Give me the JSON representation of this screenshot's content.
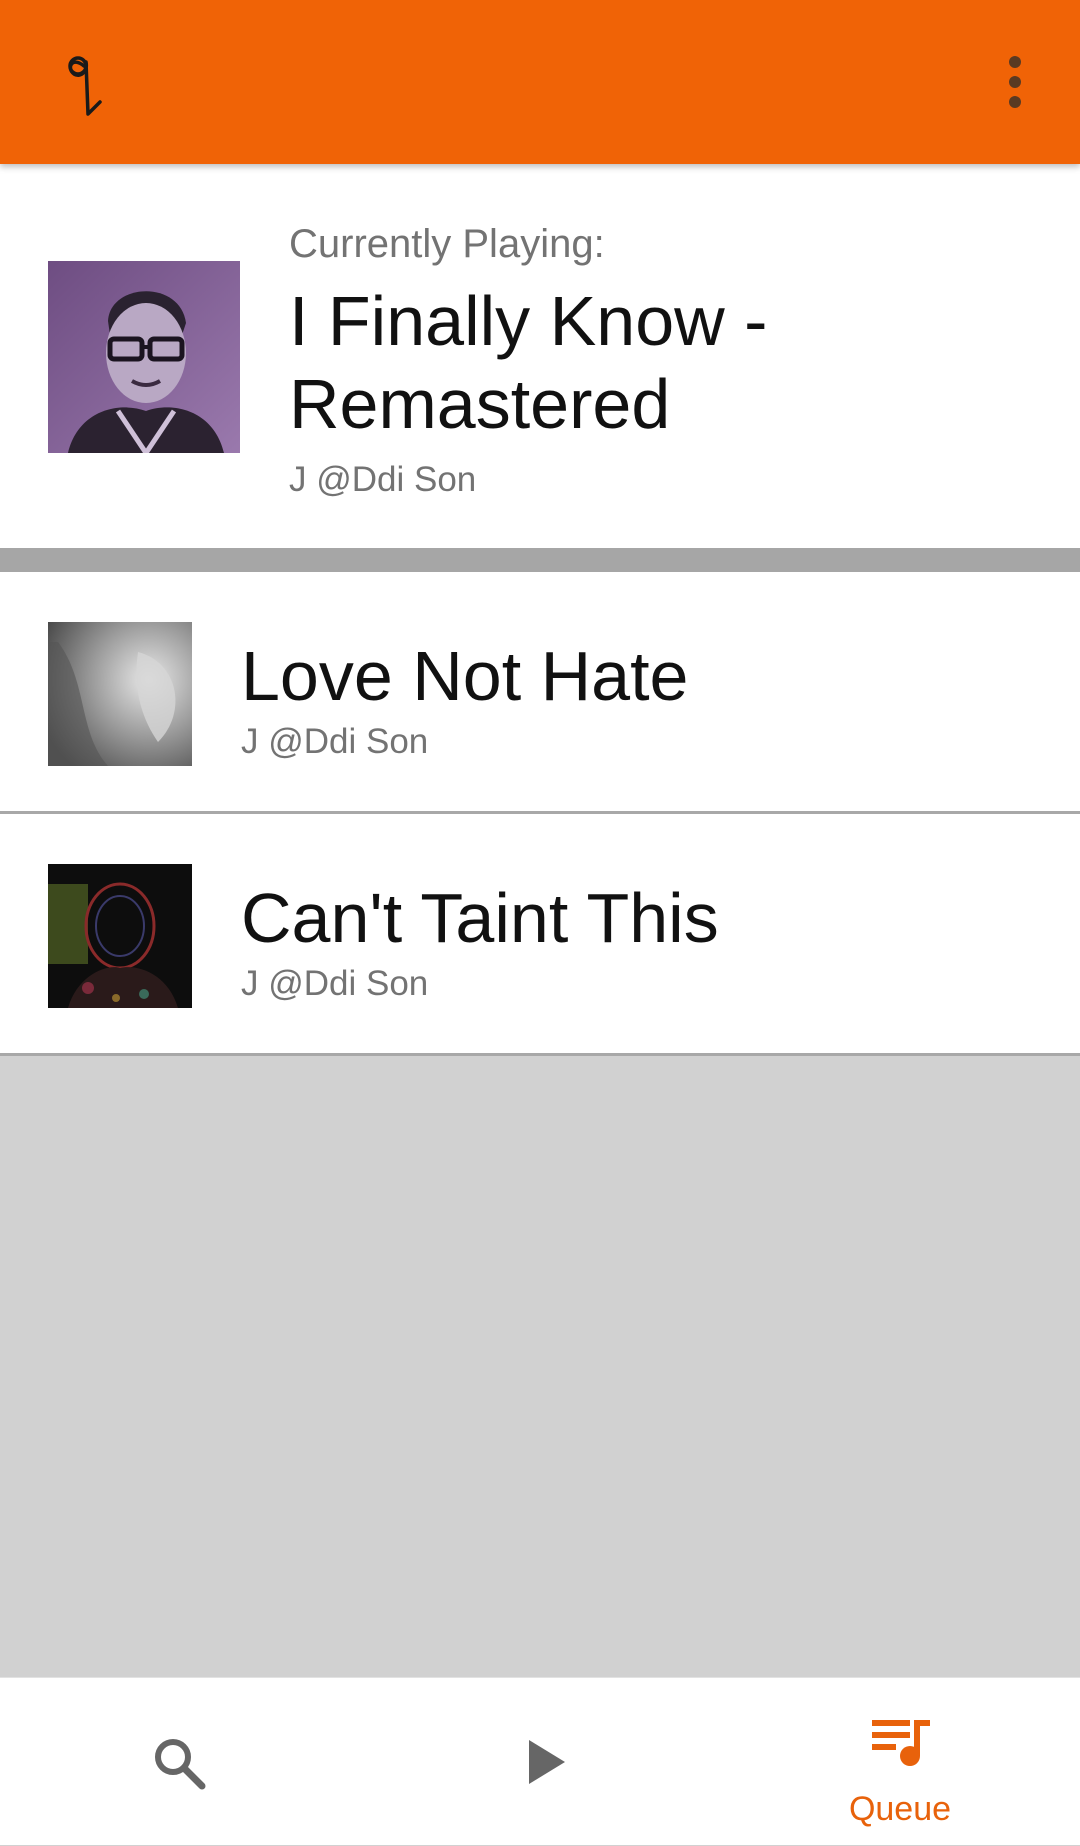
{
  "app_bar": {
    "logo_icon": "music-note-logo-icon",
    "menu_icon": "more-vert-icon",
    "background_color": "#f06306"
  },
  "now_playing": {
    "label": "Currently Playing:",
    "title": "I Finally Know - Remastered",
    "artist": "J @Ddi Son",
    "art_icon": "album-art-portrait"
  },
  "queue": {
    "items": [
      {
        "title": "Love Not Hate",
        "artist": "J @Ddi Son",
        "art_icon": "album-art-grey"
      },
      {
        "title": "Can't Taint This",
        "artist": "J @Ddi Son",
        "art_icon": "album-art-dark"
      }
    ]
  },
  "bottom_nav": {
    "items": [
      {
        "icon": "search-icon",
        "label": ""
      },
      {
        "icon": "play-icon",
        "label": ""
      },
      {
        "icon": "queue-music-icon",
        "label": "Queue",
        "active": true
      }
    ],
    "active_color": "#e8620b",
    "inactive_color": "#666666"
  }
}
